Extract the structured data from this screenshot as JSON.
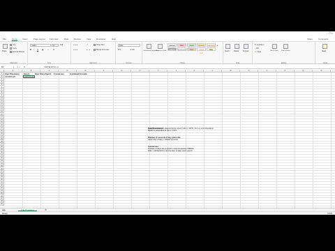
{
  "ribbon_tabs": [
    "File",
    "Home",
    "Insert",
    "Page Layout",
    "Formulas",
    "Data",
    "Review",
    "View",
    "Developer",
    "Help"
  ],
  "active_tab": "Home",
  "share_label": "Share",
  "comments_label": "Comments",
  "clipboard": {
    "paste": "Paste",
    "cut": "Cut",
    "copy": "Copy",
    "format_painter": "Format Painter",
    "group": "Clipboard"
  },
  "font": {
    "name": "Calibri",
    "size": "11",
    "group": "Font"
  },
  "alignment": {
    "wrap": "Wrap Text",
    "merge": "Merge & Center",
    "group": "Alignment"
  },
  "number": {
    "format": "Date",
    "group": "Number"
  },
  "styles": {
    "conditional": "Conditional Formatting",
    "format_table": "Format as Table",
    "items": [
      "Normal",
      "Bad",
      "Good",
      "Neutral",
      "Calculation",
      "Check Cell",
      "Explanatory ...",
      "Input",
      "Linked Cell",
      "Note"
    ],
    "group": "Styles"
  },
  "cells": {
    "insert": "Insert",
    "delete": "Delete",
    "format": "Format",
    "group": "Cells"
  },
  "editing": {
    "autosum": "AutoSum",
    "fill": "Fill",
    "clear": "Clear",
    "sort": "Sort & Filter",
    "find": "Find & Select",
    "group": "Editing"
  },
  "ideas": {
    "label": "Ideas",
    "group": "Ideas"
  },
  "formula_bar": {
    "name_box": "B2",
    "fx": "fx",
    "formula": "=DATE(1970,1,1)"
  },
  "columns": [
    "A",
    "B",
    "C",
    "D",
    "E",
    "F",
    "G",
    "H",
    "I",
    "J",
    "K",
    "L",
    "M",
    "N",
    "O",
    "P",
    "Q",
    "R",
    "S",
    "T",
    "U",
    "V",
    "W"
  ],
  "rows": [
    "1",
    "2",
    "3",
    "4",
    "5",
    "6",
    "7",
    "8",
    "9",
    "10",
    "11",
    "12",
    "13",
    "14",
    "15",
    "16",
    "17",
    "18",
    "19",
    "20",
    "21",
    "22",
    "23",
    "24",
    "25",
    "26",
    "27",
    "28",
    "29",
    "30",
    "31",
    "32",
    "33",
    "34",
    "35",
    "36",
    "37",
    "38",
    "39",
    "40",
    "41",
    "42",
    "43",
    "44",
    "45",
    "46",
    "47",
    "48",
    "49"
  ],
  "headers": {
    "a1": "Unix Timestamp",
    "b1": "Epoch",
    "c1": "Days Since Epoch",
    "d1": "Conversion",
    "e1": "Combined Formula"
  },
  "row2": {
    "a2": "1570561420",
    "b2": "1970-01-01"
  },
  "notes": {
    "unix_title": "Unix Timestamp",
    "unix_line1": "Number of seconds elapsed since epoch (Jan 1, 1970). For e.g unix timestamp",
    "unix_line2": "86400 is equivalent to Jan 2, 1970.",
    "seconds_title": "Number of seconds in any given day",
    "seconds_line1": "24(h)*60(m)*60(s) = 86400 seconds",
    "conv_title": "Conversion",
    "conv_line1": "Number of days since epoch = Unix timestamp / 86400",
    "conv_line2": "Date = DATE(1970,1,1)+Number of days since epoch"
  },
  "sheet_tab": "Unix Timestamp",
  "status": {
    "mode": "Ready",
    "zoom": "100%"
  }
}
